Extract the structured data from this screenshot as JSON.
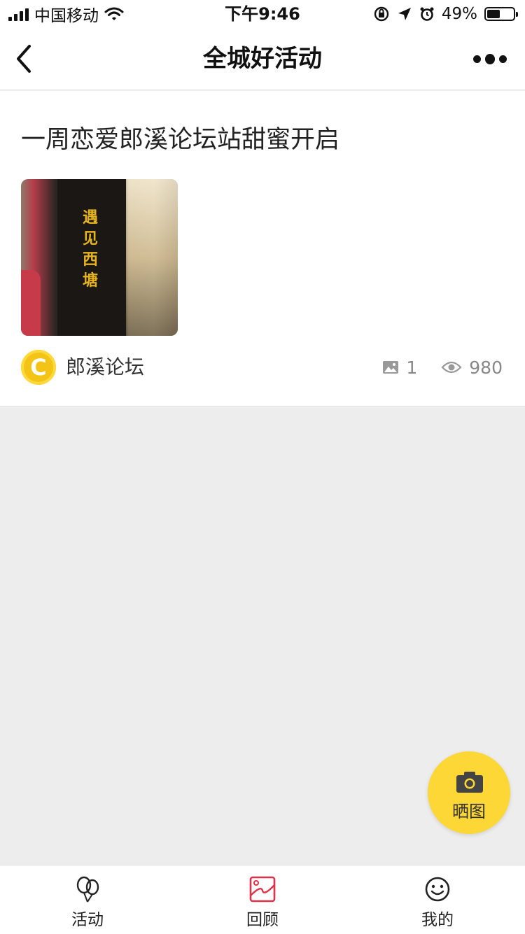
{
  "status_bar": {
    "carrier": "中国移动",
    "time": "下午9:46",
    "battery_text": "49%",
    "battery_level": 0.49
  },
  "nav": {
    "title": "全城好活动",
    "back_icon": "chevron-left-icon",
    "more_icon": "more-dots-icon"
  },
  "post": {
    "title": "一周恋爱郎溪论坛站甜蜜开启",
    "image_sign_text": "遇见西塘",
    "author": "郎溪论坛",
    "photo_count": "1",
    "view_count": "980"
  },
  "fab": {
    "label": "晒图",
    "icon": "camera-icon"
  },
  "tabs": [
    {
      "label": "活动",
      "icon": "balloons-icon"
    },
    {
      "label": "回顾",
      "icon": "review-icon",
      "active": true
    },
    {
      "label": "我的",
      "icon": "smiley-icon"
    }
  ],
  "colors": {
    "accent_yellow": "#fcd735",
    "review_red": "#e0314b",
    "background": "#ededed"
  }
}
